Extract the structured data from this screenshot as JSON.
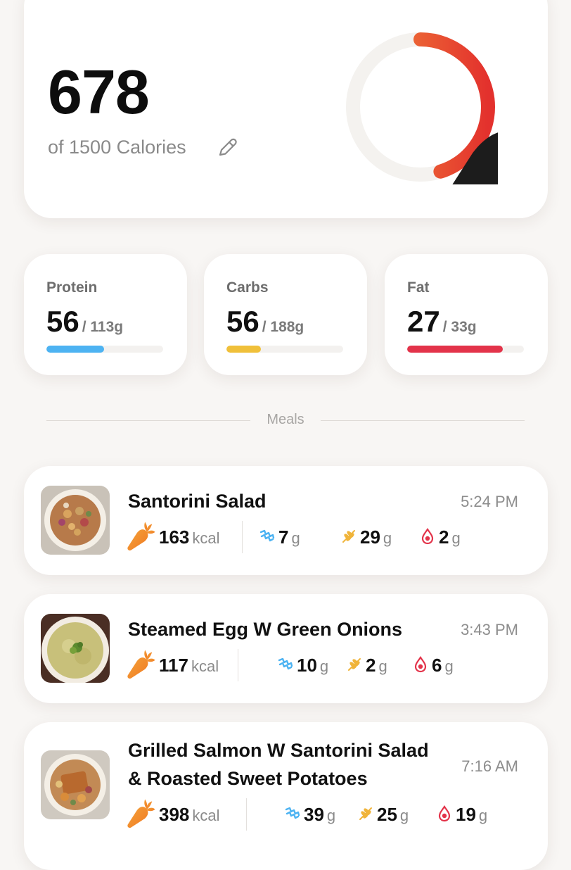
{
  "summary": {
    "calories_eaten": "678",
    "calories_goal_text": "of 1500 Calories",
    "progress_fraction": 0.452,
    "ring_colors": [
      "#f28a3a",
      "#e3312d"
    ]
  },
  "macros": [
    {
      "label": "Protein",
      "value": "56",
      "total": "/ 113g",
      "fraction": 0.496,
      "color": "#4db3f2"
    },
    {
      "label": "Carbs",
      "value": "56",
      "total": "/ 188g",
      "fraction": 0.298,
      "color": "#f0c03a"
    },
    {
      "label": "Fat",
      "value": "27",
      "total": "/ 33g",
      "fraction": 0.818,
      "color": "#e3334a"
    }
  ],
  "meals_header": "Meals",
  "meals": [
    {
      "title": "Santorini Salad",
      "time": "5:24 PM",
      "kcal": "163",
      "kcal_unit": "kcal",
      "protein": "7",
      "carbs": "29",
      "fat": "2",
      "unit": "g"
    },
    {
      "title": "Steamed Egg W Green Onions",
      "time": "3:43 PM",
      "kcal": "117",
      "kcal_unit": "kcal",
      "protein": "10",
      "carbs": "2",
      "fat": "6",
      "unit": "g"
    },
    {
      "title_line1": "Grilled Salmon W Santorini Salad",
      "title_line2": "& Roasted Sweet Potatoes",
      "time": "7:16 AM",
      "kcal": "398",
      "kcal_unit": "kcal",
      "protein": "39",
      "carbs": "25",
      "fat": "19",
      "unit": "g"
    }
  ],
  "icons": {
    "carrot": "carrot-icon",
    "protein": "protein-icon",
    "carbs": "wheat-icon",
    "fat": "fat-drop-icon",
    "edit": "pencil-icon"
  }
}
